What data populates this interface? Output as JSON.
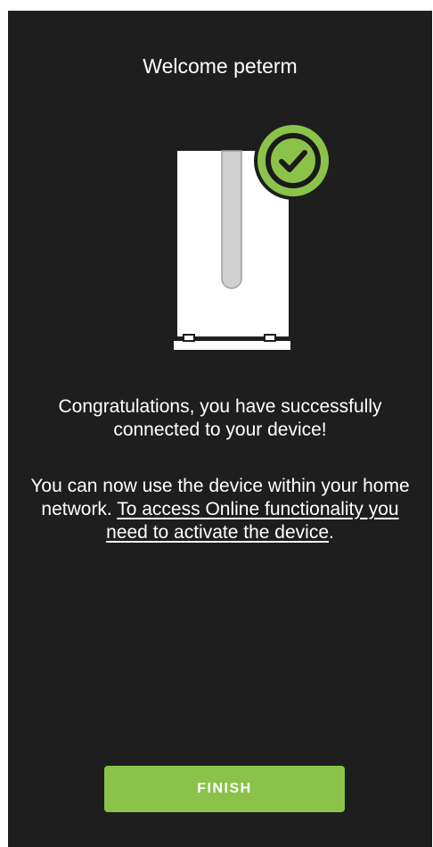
{
  "header": {
    "title": "Welcome peterm"
  },
  "illustration": {
    "device_icon": "router-device-icon",
    "status_icon": "check-circle-icon",
    "status_color": "#8bc34a"
  },
  "message": {
    "congrats": "Congratulations, you have successfully connected to your device!",
    "info_prefix": "You can now use the device within your home network. ",
    "link_part1": "To access Online functionality you need to activate the",
    "link_part2": "device",
    "info_suffix": "."
  },
  "actions": {
    "finish_label": "FINISH",
    "finish_color": "#8bc34a"
  },
  "theme": {
    "background": "#1e1e1e",
    "text": "#ffffff",
    "accent": "#8bc34a"
  }
}
